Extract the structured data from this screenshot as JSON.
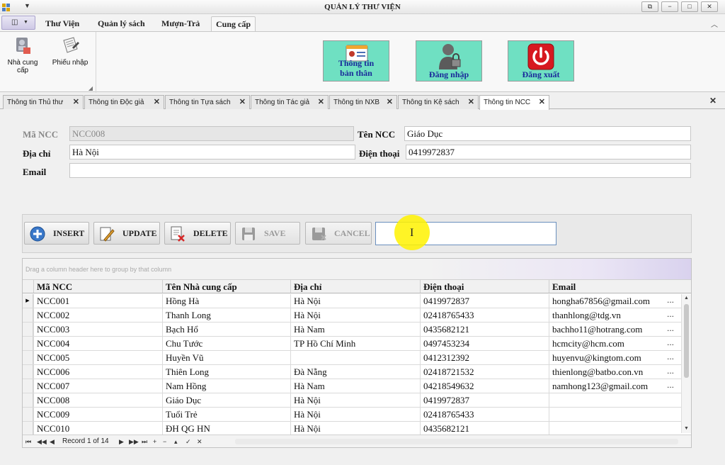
{
  "window": {
    "title": "QUẢN LÝ THƯ VIỆN",
    "controls": [
      "⧉",
      "−",
      "□",
      "✕"
    ]
  },
  "ribbon": {
    "tabs": [
      {
        "label": "Thư Viện"
      },
      {
        "label": "Quản lý sách"
      },
      {
        "label": "Mượn-Trả"
      },
      {
        "label": "Cung cấp"
      }
    ],
    "active_tab": "Cung cấp",
    "group_buttons": [
      {
        "label": "Nhà cung\ncấp",
        "icon": "supplier-icon"
      },
      {
        "label": "Phiếu nhập",
        "icon": "import-slip-icon"
      }
    ],
    "big_buttons": [
      {
        "label": "Thông tin bản thân",
        "icon": "profile-card-icon"
      },
      {
        "label": "Đăng nhập",
        "icon": "login-user-lock-icon"
      },
      {
        "label": "Đăng xuất",
        "icon": "power-icon"
      }
    ]
  },
  "doc_tabs": [
    {
      "label": "Thông tin Thủ thư"
    },
    {
      "label": "Thông tin Độc giả"
    },
    {
      "label": "Thông tin Tựa sách"
    },
    {
      "label": "Thông tin Tác giả"
    },
    {
      "label": "Thông tin NXB"
    },
    {
      "label": "Thông tin Kệ sách"
    },
    {
      "label": "Thông tin NCC"
    }
  ],
  "active_doc_tab": "Thông tin NCC",
  "form": {
    "ma_ncc_label": "Mã NCC",
    "ma_ncc_value": "NCC008",
    "ten_ncc_label": "Tên NCC",
    "ten_ncc_value": "Giáo Dục",
    "dia_chi_label": "Địa chỉ",
    "dia_chi_value": "Hà Nội",
    "dien_thoai_label": "Điện thoại",
    "dien_thoai_value": "0419972837",
    "email_label": "Email",
    "email_value": ""
  },
  "toolbar": {
    "insert": "INSERT",
    "update": "UPDATE",
    "delete": "DELETE",
    "save": "SAVE",
    "cancel": "CANCEL",
    "search_value": ""
  },
  "grid": {
    "group_hint": "Drag a column header here to group by that column",
    "columns": [
      "Mã NCC",
      "Tên Nhà cung cấp",
      "Địa chỉ",
      "Điện thoại",
      "Email"
    ],
    "rows": [
      [
        "NCC001",
        "Hồng Hà",
        "Hà Nội",
        "0419972837",
        "hongha67856@gmail.com"
      ],
      [
        "NCC002",
        "Thanh Long",
        "Hà Nội",
        "02418765433",
        "thanhlong@tdg.vn"
      ],
      [
        "NCC003",
        "Bạch Hổ",
        "Hà Nam",
        "0435682121",
        "bachho11@hotrang.com"
      ],
      [
        "NCC004",
        "Chu Tước",
        "TP Hồ Chí Minh",
        "0497453234",
        "hcmcity@hcm.com"
      ],
      [
        "NCC005",
        "Huyền Vũ",
        "",
        "0412312392",
        "huyenvu@kingtom.com"
      ],
      [
        "NCC006",
        "Thiên Long",
        "Đà Nẵng",
        "02418721532",
        "thienlong@batbo.con.vn"
      ],
      [
        "NCC007",
        "Nam Hồng",
        "Hà Nam",
        "04218549632",
        "namhong123@gmail.com"
      ],
      [
        "NCC008",
        "Giáo Dục",
        "Hà Nội",
        "0419972837",
        ""
      ],
      [
        "NCC009",
        "Tuổi Trẻ",
        "Hà Nội",
        "02418765433",
        ""
      ],
      [
        "NCC010",
        "ĐH QG HN",
        "Hà Nội",
        "0435682121",
        ""
      ]
    ],
    "ellipsis": "...",
    "record_text": "Record 1 of 14"
  }
}
